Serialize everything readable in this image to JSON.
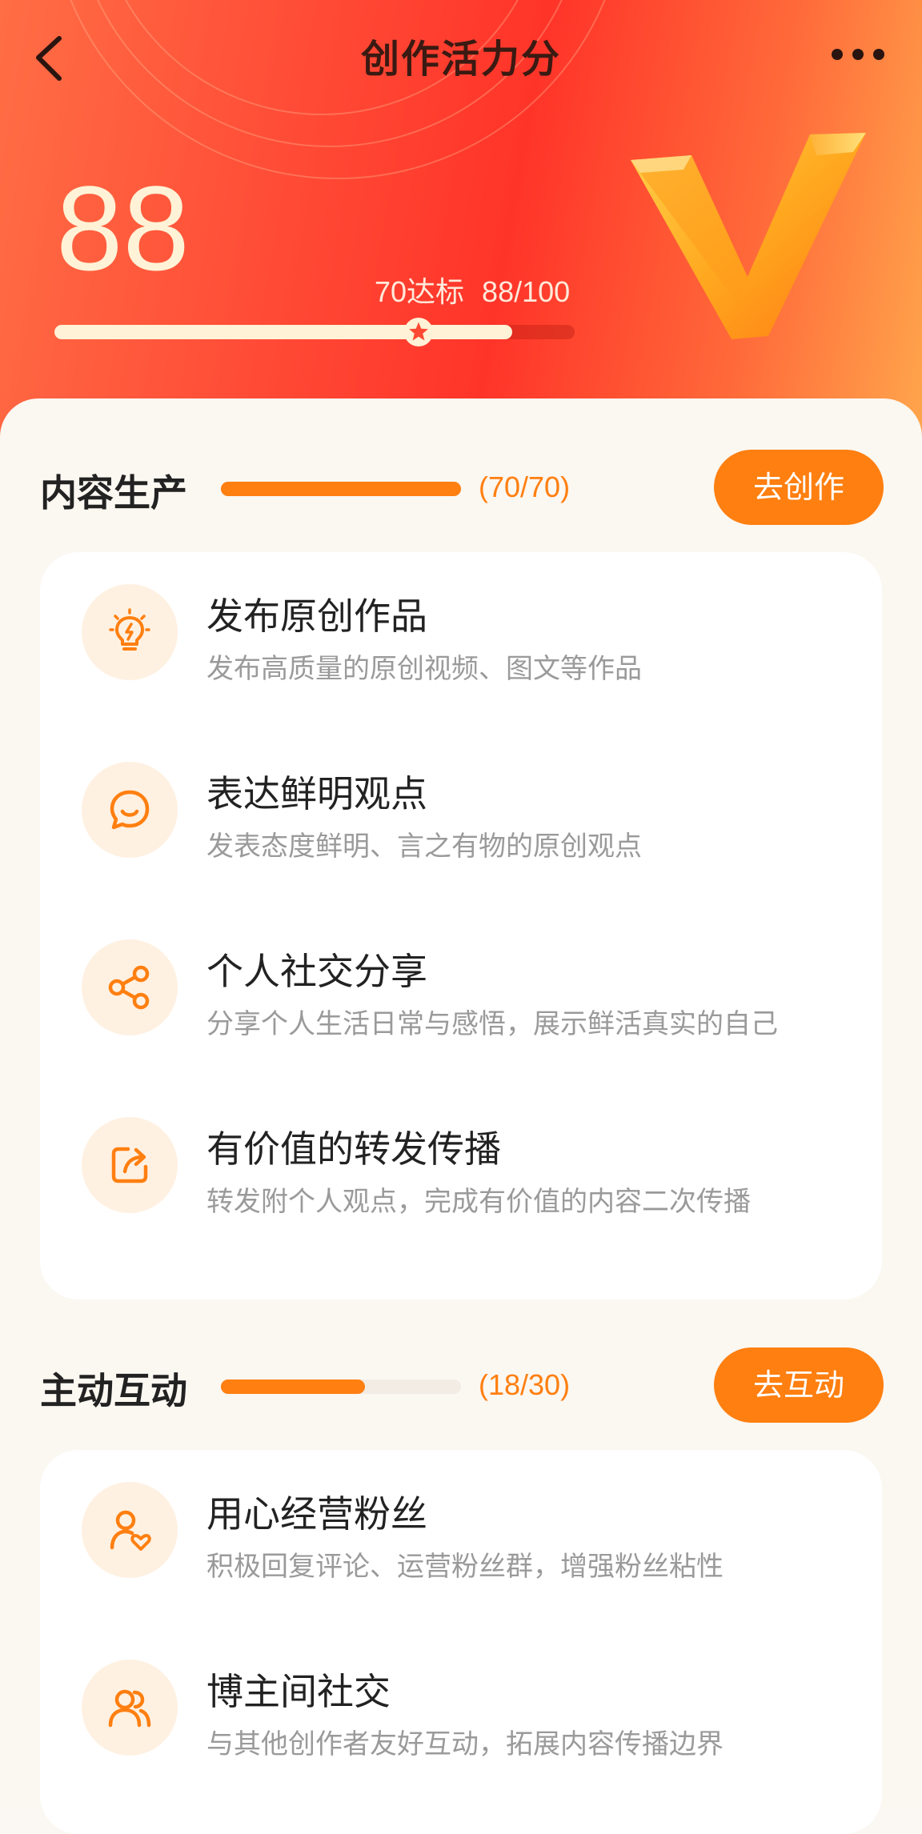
{
  "nav": {
    "title": "创作活力分",
    "back_icon": "chevron-left-icon",
    "more_icon": "more-dots-icon"
  },
  "summary": {
    "score": "88",
    "standard_label": "70达标",
    "score_fraction": "88/100",
    "progress_fraction": 0.88,
    "standard_fraction": 0.7
  },
  "sections": [
    {
      "title": "内容生产",
      "count": "(70/70)",
      "progress_fraction": 1.0,
      "button_label": "去创作",
      "items": [
        {
          "icon": "lightbulb-icon",
          "title": "发布原创作品",
          "desc": "发布高质量的原创视频、图文等作品"
        },
        {
          "icon": "chat-bubble-icon",
          "title": "表达鲜明观点",
          "desc": "发表态度鲜明、言之有物的原创观点"
        },
        {
          "icon": "share-icon",
          "title": "个人社交分享",
          "desc": "分享个人生活日常与感悟，展示鲜活真实的自己"
        },
        {
          "icon": "forward-icon",
          "title": "有价值的转发传播",
          "desc": "转发附个人观点，完成有价值的内容二次传播"
        }
      ]
    },
    {
      "title": "主动互动",
      "count": "(18/30)",
      "progress_fraction": 0.6,
      "button_label": "去互动",
      "items": [
        {
          "icon": "user-heart-icon",
          "title": "用心经营粉丝",
          "desc": "积极回复评论、运营粉丝群，增强粉丝粘性"
        },
        {
          "icon": "users-icon",
          "title": "博主间社交",
          "desc": "与其他创作者友好互动，拓展内容传播边界"
        }
      ]
    }
  ],
  "colors": {
    "accent": "#FF7F10",
    "header_red": "#FF3429",
    "score_cream": "#FFF2D6"
  }
}
